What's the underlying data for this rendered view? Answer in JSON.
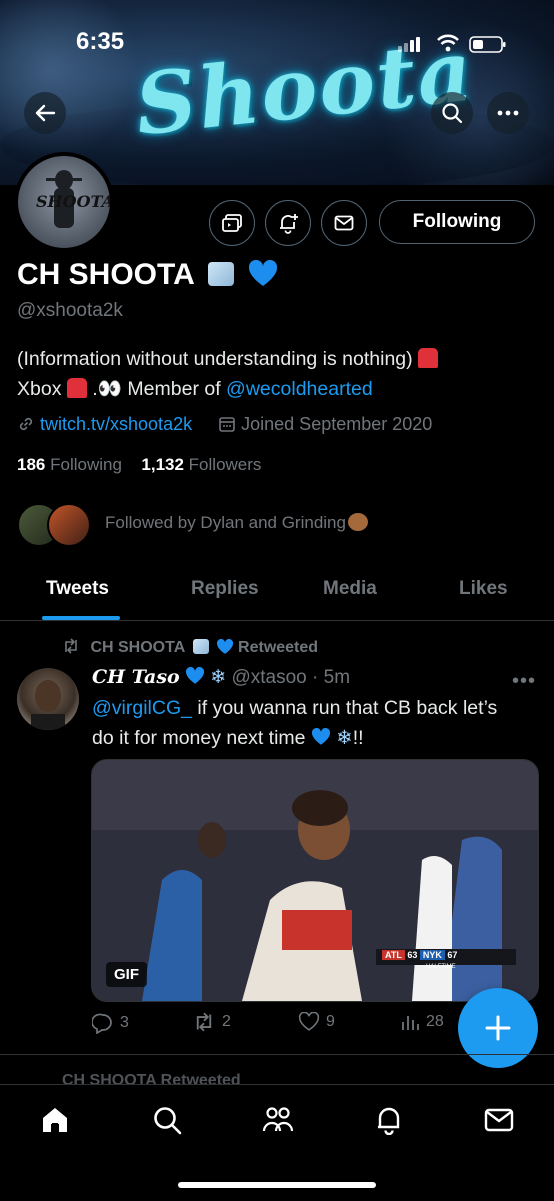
{
  "status_bar": {
    "time": "6:35"
  },
  "banner": {
    "title": "Shoota"
  },
  "avatar": {
    "text": "SHOOTA"
  },
  "profile": {
    "name": "CH SHOOTA",
    "handle": "@xshoota2k",
    "bio_line1": "(Information without understanding is nothing)",
    "bio_line2_prefix": "Xbox",
    "bio_line2_mid": "Member of",
    "bio_mention": "@wecoldhearted",
    "website": "twitch.tv/xshoota2k",
    "joined": "Joined September 2020",
    "following_count": "186",
    "following_label": "Following",
    "followers_count": "1,132",
    "followers_label": "Followers",
    "followed_by": "Followed by Dylan and Grinding"
  },
  "buttons": {
    "following": "Following"
  },
  "tabs": [
    {
      "label": "Tweets",
      "active": true
    },
    {
      "label": "Replies",
      "active": false
    },
    {
      "label": "Media",
      "active": false
    },
    {
      "label": "Likes",
      "active": false
    }
  ],
  "tweet": {
    "retweeted_by": "CH SHOOTA",
    "retweeted_label": "Retweeted",
    "author_name": "CH Taso",
    "author_handle": "@xtasoo",
    "time": "5m",
    "mention": "@virgilCG_",
    "text_1": "if you wanna run that CB back let’s",
    "text_2": "do it for money next time",
    "text_end": "!!",
    "media_badge": "GIF",
    "scoreboard": {
      "team1": "ATL",
      "score1": "63",
      "team2": "NYK",
      "score2": "67",
      "period": "HALFTIME"
    },
    "replies": "3",
    "retweets": "2",
    "likes": "9",
    "views": "28"
  },
  "next_tweet": {
    "retweeted_by": "CH SHOOTA",
    "retweeted_label": "Retweeted"
  },
  "colors": {
    "accent": "#1d9bf0",
    "muted": "#71767b",
    "background": "#000000"
  }
}
